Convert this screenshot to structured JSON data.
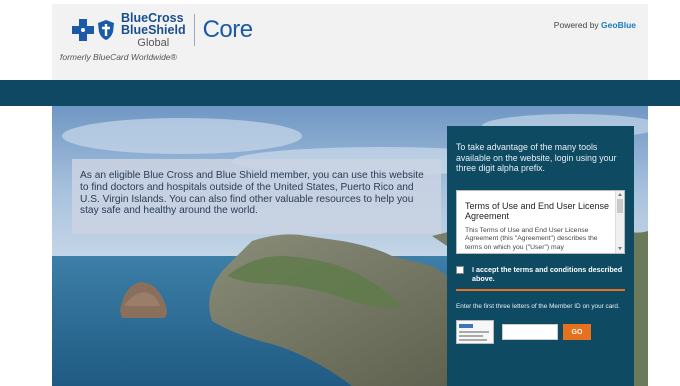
{
  "header": {
    "brand_line1": "BlueCross",
    "brand_line2": "BlueShield",
    "brand_line3": "Global",
    "product": "Core",
    "formerly": "formerly BlueCard Worldwide®",
    "powered_by": "Powered by ",
    "powered_brand": "GeoBlue"
  },
  "intro": {
    "text": "As an eligible Blue Cross and Blue Shield member, you can use this website to find doctors and hospitals outside of the United States, Puerto Rico and U.S. Virgin Islands. You can also find other valuable resources to help you stay safe and healthy around the world."
  },
  "login": {
    "intro": "To take advantage of the many tools available on the website, login using your three digit alpha prefix.",
    "terms_title": "Terms of Use and End User License Agreement",
    "terms_text": "This Terms of Use and End User License Agreement (this \"Agreement\") describes the terms on which you (\"User\") may",
    "accept_label": "I accept the terms and conditions described above.",
    "member_label": "Enter the first three letters of the Member ID on your card.",
    "go_label": "GO"
  },
  "colors": {
    "navbar": "#0e4863",
    "panel": "#0f4a63",
    "accent": "#e5701e",
    "brand_blue": "#1a5aa6"
  },
  "icons": [
    "blue-cross-icon",
    "blue-shield-icon",
    "member-card-icon"
  ]
}
